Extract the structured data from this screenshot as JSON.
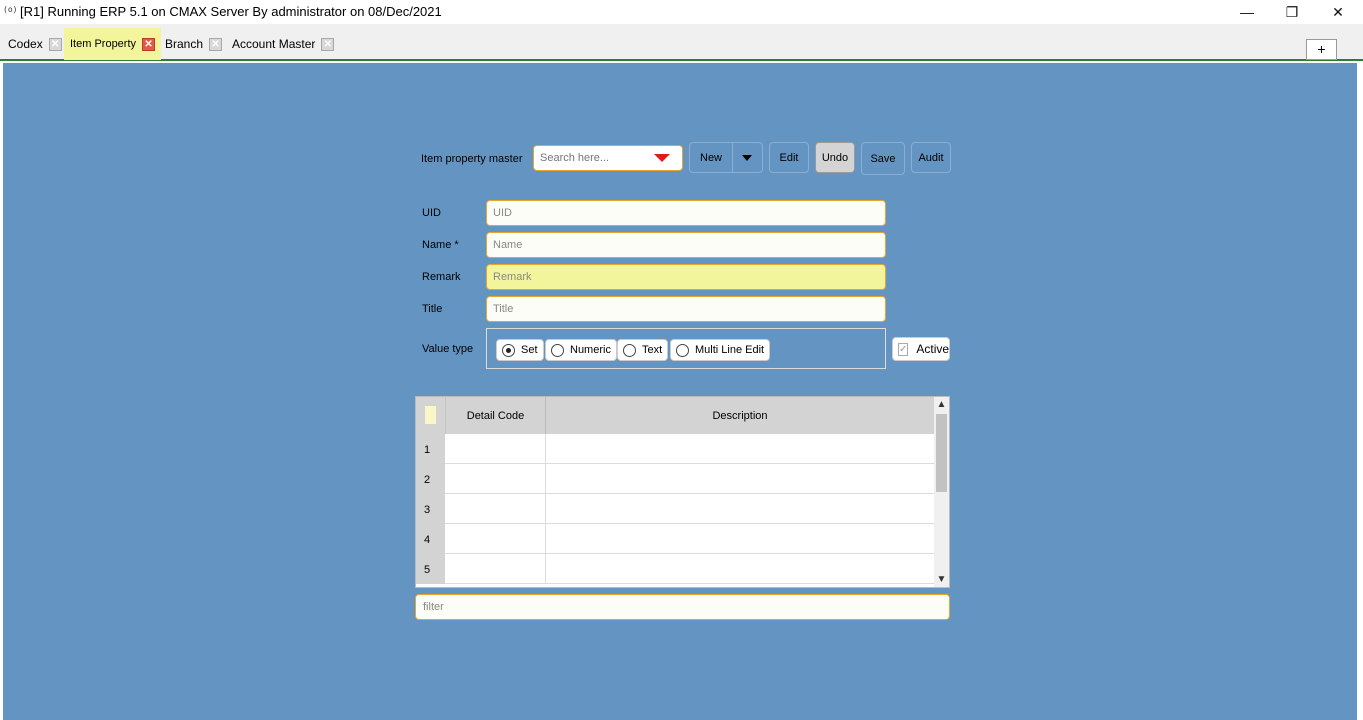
{
  "window": {
    "icon_text": "(o)",
    "title": "[R1] Running ERP 5.1 on CMAX Server By administrator on 08/Dec/2021",
    "minimize": "—",
    "restore": "❐",
    "close": "✕"
  },
  "tabs": [
    {
      "label": "Codex",
      "close": "✕"
    },
    {
      "label": "Item Property",
      "close": "✕"
    },
    {
      "label": "Branch",
      "close": "✕"
    },
    {
      "label": "Account Master",
      "close": "✕"
    }
  ],
  "tab_add": "+",
  "toolbar": {
    "label": "Item property master",
    "search_placeholder": "Search here...",
    "new": "New",
    "edit": "Edit",
    "undo": "Undo",
    "save": "Save",
    "audit": "Audit"
  },
  "form": {
    "uid_label": "UID",
    "uid_placeholder": "UID",
    "name_label": "Name *",
    "name_placeholder": "Name",
    "remark_label": "Remark",
    "remark_placeholder": "Remark",
    "title_label": "Title",
    "title_placeholder": "Title",
    "value_type_label": "Value type",
    "value_types": [
      {
        "label": "Set",
        "checked": true
      },
      {
        "label": "Numeric",
        "checked": false
      },
      {
        "label": "Text",
        "checked": false
      },
      {
        "label": "Multi Line Edit",
        "checked": false
      }
    ],
    "active_label": "Active",
    "active_checked": true
  },
  "grid": {
    "columns": [
      "Detail Code",
      "Description"
    ],
    "rows": [
      {
        "num": "1",
        "code": "",
        "description": ""
      },
      {
        "num": "2",
        "code": "",
        "description": ""
      },
      {
        "num": "3",
        "code": "",
        "description": ""
      },
      {
        "num": "4",
        "code": "",
        "description": ""
      },
      {
        "num": "5",
        "code": "",
        "description": ""
      }
    ],
    "scroll_up": "▲",
    "scroll_down": "▼"
  },
  "filter_placeholder": "filter",
  "colors": {
    "panel": "#6495c2",
    "accent_border": "#e8a72a",
    "highlight": "#f2f59b",
    "tab_underline": "#2e7d32",
    "search_arrow": "#e01b1b"
  }
}
